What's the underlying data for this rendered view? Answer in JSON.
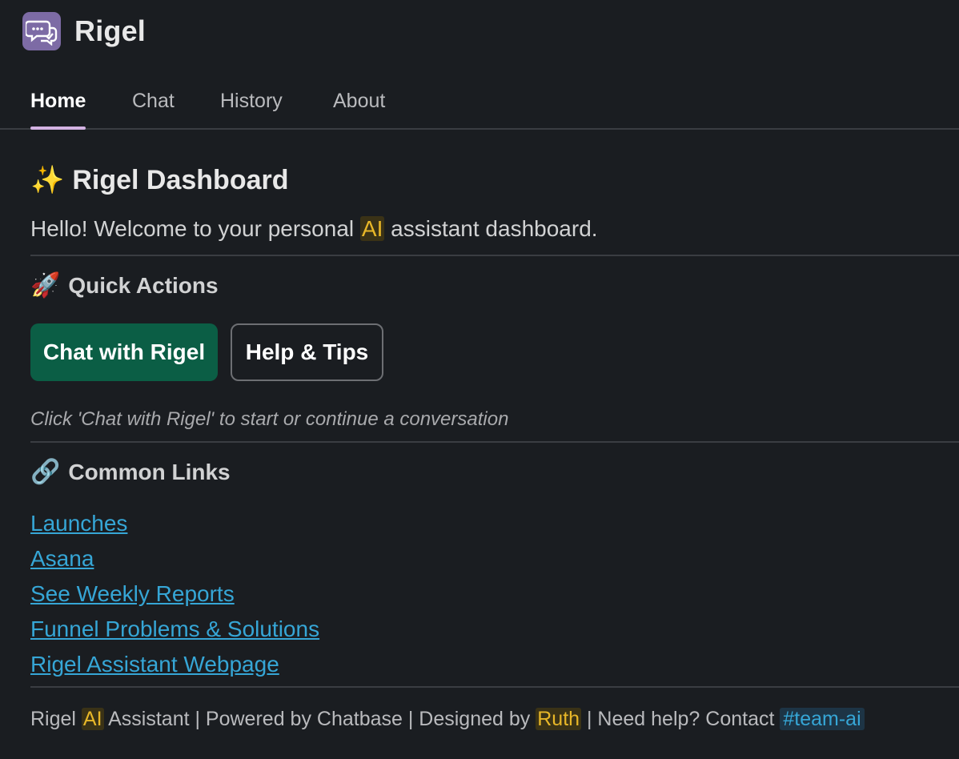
{
  "app": {
    "name": "Rigel",
    "icon": "chat-bubbles-icon"
  },
  "tabs": [
    {
      "label": "Home",
      "active": true
    },
    {
      "label": "Chat",
      "active": false
    },
    {
      "label": "History",
      "active": false
    },
    {
      "label": "About",
      "active": false
    }
  ],
  "dashboard": {
    "title_emoji": "✨",
    "title": "Rigel Dashboard",
    "welcome_before": "Hello! Welcome to your personal ",
    "welcome_highlight": "AI",
    "welcome_after": " assistant dashboard."
  },
  "quick_actions": {
    "emoji": "🚀",
    "title": "Quick Actions",
    "primary_button": "Chat with Rigel",
    "secondary_button": "Help & Tips",
    "hint": "Click 'Chat with Rigel' to start or continue a conversation"
  },
  "common_links": {
    "emoji": "🔗",
    "title": "Common Links",
    "items": [
      "Launches",
      "Asana",
      "See Weekly Reports",
      "Funnel Problems & Solutions",
      "Rigel Assistant Webpage"
    ]
  },
  "footer": {
    "part1": "Rigel ",
    "hl1": "AI",
    "part2": " Assistant | Powered by Chatbase | Designed by ",
    "hl2": "Ruth",
    "part3": " | Need help? Contact ",
    "channel": "#team-ai"
  },
  "colors": {
    "accent_purple": "#7d6ba5",
    "primary_button": "#0b5e45",
    "link": "#36a6d6",
    "highlight": "#e8b728"
  }
}
